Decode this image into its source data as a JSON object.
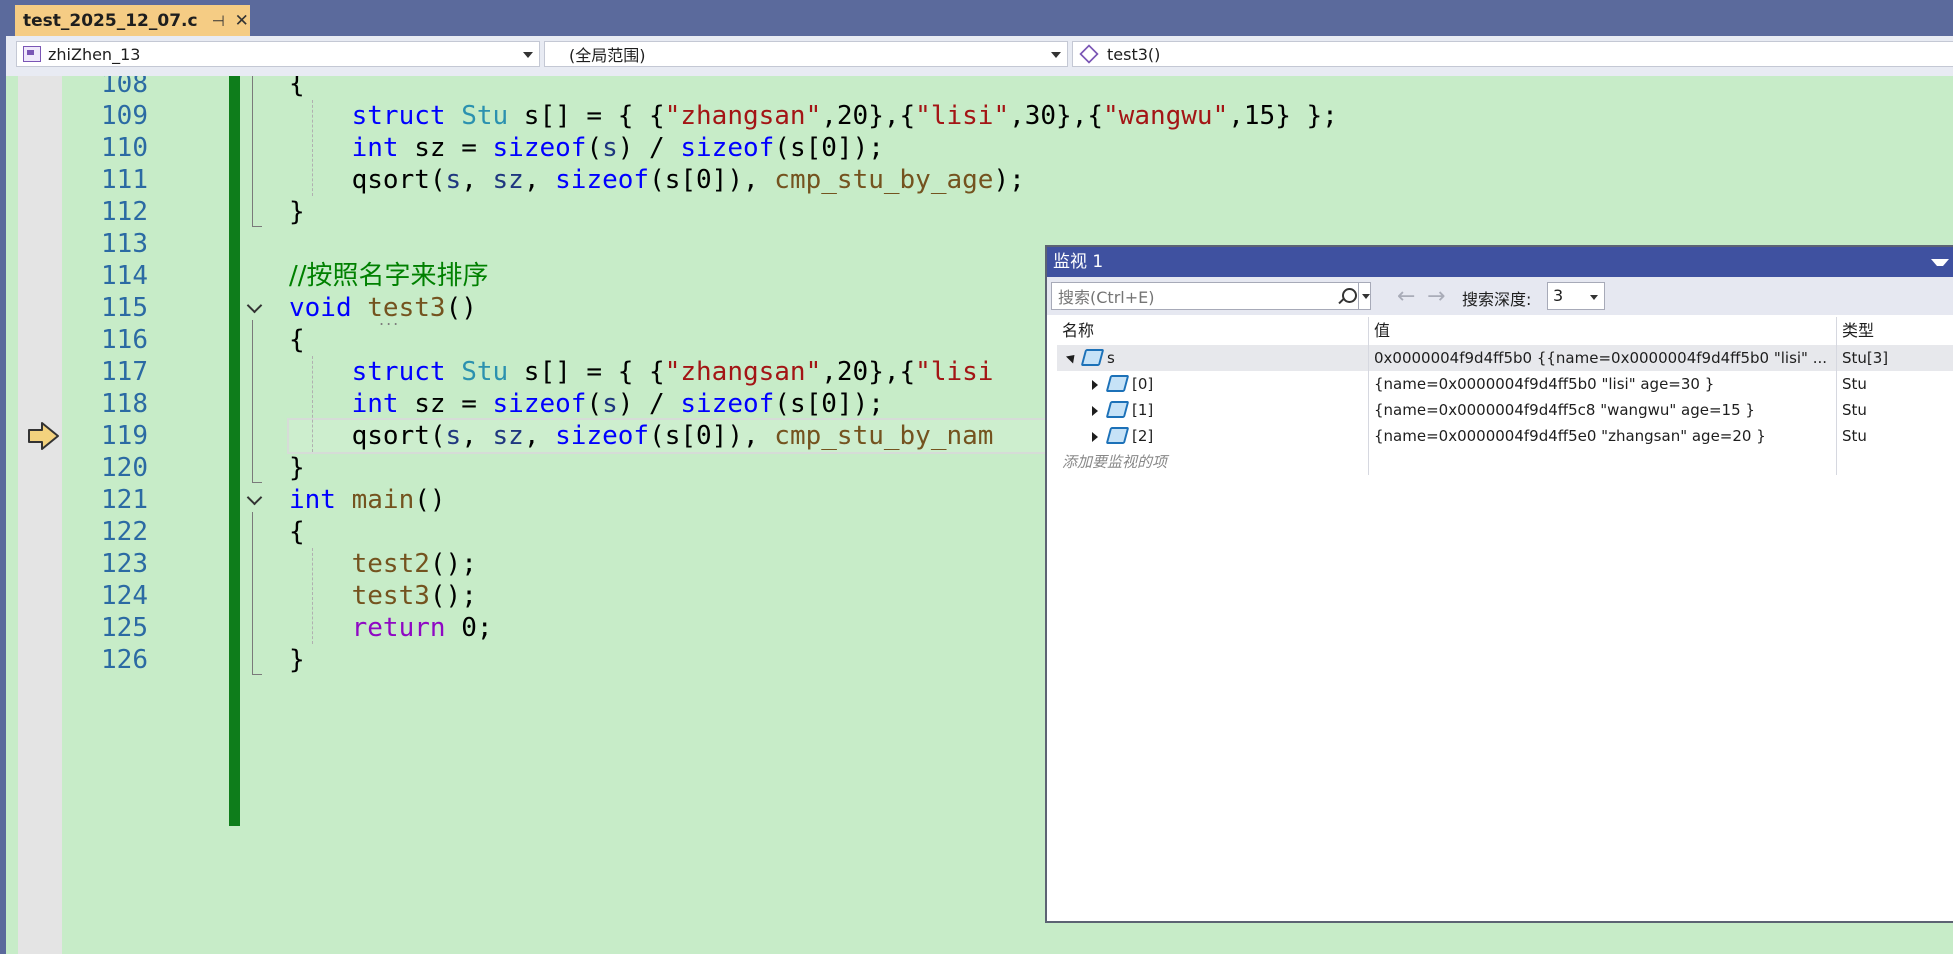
{
  "tab": {
    "title": "test_2025_12_07.c",
    "pin": "⊣",
    "close": "✕"
  },
  "navbar": {
    "project": "zhiZhen_13",
    "scope": "(全局范围)",
    "function": "test3()"
  },
  "editor": {
    "lines": [
      {
        "n": "108",
        "tokens": [
          {
            "t": "{",
            "c": ""
          }
        ]
      },
      {
        "n": "109",
        "tokens": [
          {
            "t": "    struct ",
            "c": "kw"
          },
          {
            "t": "Stu",
            "c": "ty"
          },
          {
            "t": " s[] = { {",
            "c": ""
          },
          {
            "t": "\"zhangsan\"",
            "c": "str"
          },
          {
            "t": ",20},{",
            "c": ""
          },
          {
            "t": "\"lisi\"",
            "c": "str"
          },
          {
            "t": ",30},{",
            "c": ""
          },
          {
            "t": "\"wangwu\"",
            "c": "str"
          },
          {
            "t": ",15} };",
            "c": ""
          }
        ]
      },
      {
        "n": "110",
        "tokens": [
          {
            "t": "    int ",
            "c": "kw"
          },
          {
            "t": "sz = ",
            "c": ""
          },
          {
            "t": "sizeof",
            "c": "kw"
          },
          {
            "t": "(",
            "c": ""
          },
          {
            "t": "s",
            "c": "var"
          },
          {
            "t": ") / ",
            "c": ""
          },
          {
            "t": "sizeof",
            "c": "kw"
          },
          {
            "t": "(s[0]);",
            "c": ""
          }
        ]
      },
      {
        "n": "111",
        "tokens": [
          {
            "t": "    qsort(",
            "c": ""
          },
          {
            "t": "s",
            "c": "var"
          },
          {
            "t": ", ",
            "c": ""
          },
          {
            "t": "sz",
            "c": "var"
          },
          {
            "t": ", ",
            "c": ""
          },
          {
            "t": "sizeof",
            "c": "kw"
          },
          {
            "t": "(s[0]), ",
            "c": ""
          },
          {
            "t": "cmp_stu_by_age",
            "c": "fn"
          },
          {
            "t": ");",
            "c": ""
          }
        ]
      },
      {
        "n": "112",
        "tokens": [
          {
            "t": "}",
            "c": ""
          }
        ]
      },
      {
        "n": "113",
        "tokens": []
      },
      {
        "n": "114",
        "tokens": [
          {
            "t": "//按照名字来排序",
            "c": "cm"
          }
        ]
      },
      {
        "n": "115",
        "tokens": [
          {
            "t": "void ",
            "c": "kw"
          },
          {
            "t": "test3",
            "c": "fn"
          },
          {
            "t": "()",
            "c": ""
          }
        ]
      },
      {
        "n": "116",
        "tokens": [
          {
            "t": "{",
            "c": ""
          }
        ]
      },
      {
        "n": "117",
        "tokens": [
          {
            "t": "    struct ",
            "c": "kw"
          },
          {
            "t": "Stu",
            "c": "ty"
          },
          {
            "t": " s[] = { {",
            "c": ""
          },
          {
            "t": "\"zhangsan\"",
            "c": "str"
          },
          {
            "t": ",20},{",
            "c": ""
          },
          {
            "t": "\"lisi",
            "c": "str"
          }
        ]
      },
      {
        "n": "118",
        "tokens": [
          {
            "t": "    int ",
            "c": "kw"
          },
          {
            "t": "sz = ",
            "c": ""
          },
          {
            "t": "sizeof",
            "c": "kw"
          },
          {
            "t": "(",
            "c": ""
          },
          {
            "t": "s",
            "c": "var"
          },
          {
            "t": ") / ",
            "c": ""
          },
          {
            "t": "sizeof",
            "c": "kw"
          },
          {
            "t": "(s[0]);",
            "c": ""
          }
        ]
      },
      {
        "n": "119",
        "tokens": [
          {
            "t": "    qsort(",
            "c": ""
          },
          {
            "t": "s",
            "c": "var"
          },
          {
            "t": ", ",
            "c": ""
          },
          {
            "t": "sz",
            "c": "var"
          },
          {
            "t": ", ",
            "c": ""
          },
          {
            "t": "sizeof",
            "c": "kw"
          },
          {
            "t": "(s[0]), ",
            "c": ""
          },
          {
            "t": "cmp_stu_by_nam",
            "c": "fn"
          }
        ]
      },
      {
        "n": "120",
        "tokens": [
          {
            "t": "}",
            "c": ""
          }
        ]
      },
      {
        "n": "121",
        "tokens": [
          {
            "t": "int ",
            "c": "kw"
          },
          {
            "t": "main",
            "c": "fn"
          },
          {
            "t": "()",
            "c": ""
          }
        ]
      },
      {
        "n": "122",
        "tokens": [
          {
            "t": "{",
            "c": ""
          }
        ]
      },
      {
        "n": "123",
        "tokens": [
          {
            "t": "    ",
            "c": ""
          },
          {
            "t": "test2",
            "c": "fn"
          },
          {
            "t": "();",
            "c": ""
          }
        ]
      },
      {
        "n": "124",
        "tokens": [
          {
            "t": "    ",
            "c": ""
          },
          {
            "t": "test3",
            "c": "fn"
          },
          {
            "t": "();",
            "c": ""
          }
        ]
      },
      {
        "n": "125",
        "tokens": [
          {
            "t": "    ",
            "c": ""
          },
          {
            "t": "return ",
            "c": "ret"
          },
          {
            "t": "0;",
            "c": ""
          }
        ]
      },
      {
        "n": "126",
        "tokens": [
          {
            "t": "}",
            "c": ""
          }
        ]
      }
    ],
    "current_line": "119",
    "code_lens_dots": "..."
  },
  "watch": {
    "title": "监视 1",
    "search_placeholder": "搜索(Ctrl+E)",
    "back": "←",
    "forward": "→",
    "depth_label": "搜索深度:",
    "depth_value": "3",
    "columns": {
      "name": "名称",
      "value": "值",
      "type": "类型"
    },
    "rows": [
      {
        "name": "s",
        "value": "0x0000004f9d4ff5b0 {{name=0x0000004f9d4ff5b0 \"lisi\" ...",
        "type": "Stu[3]",
        "level": 0,
        "expanded": true
      },
      {
        "name": "[0]",
        "value": "{name=0x0000004f9d4ff5b0 \"lisi\" age=30 }",
        "type": "Stu",
        "level": 1,
        "expanded": false
      },
      {
        "name": "[1]",
        "value": "{name=0x0000004f9d4ff5c8 \"wangwu\" age=15 }",
        "type": "Stu",
        "level": 1,
        "expanded": false
      },
      {
        "name": "[2]",
        "value": "{name=0x0000004f9d4ff5e0 \"zhangsan\" age=20 }",
        "type": "Stu",
        "level": 1,
        "expanded": false
      }
    ],
    "add_item": "添加要监视的项"
  }
}
